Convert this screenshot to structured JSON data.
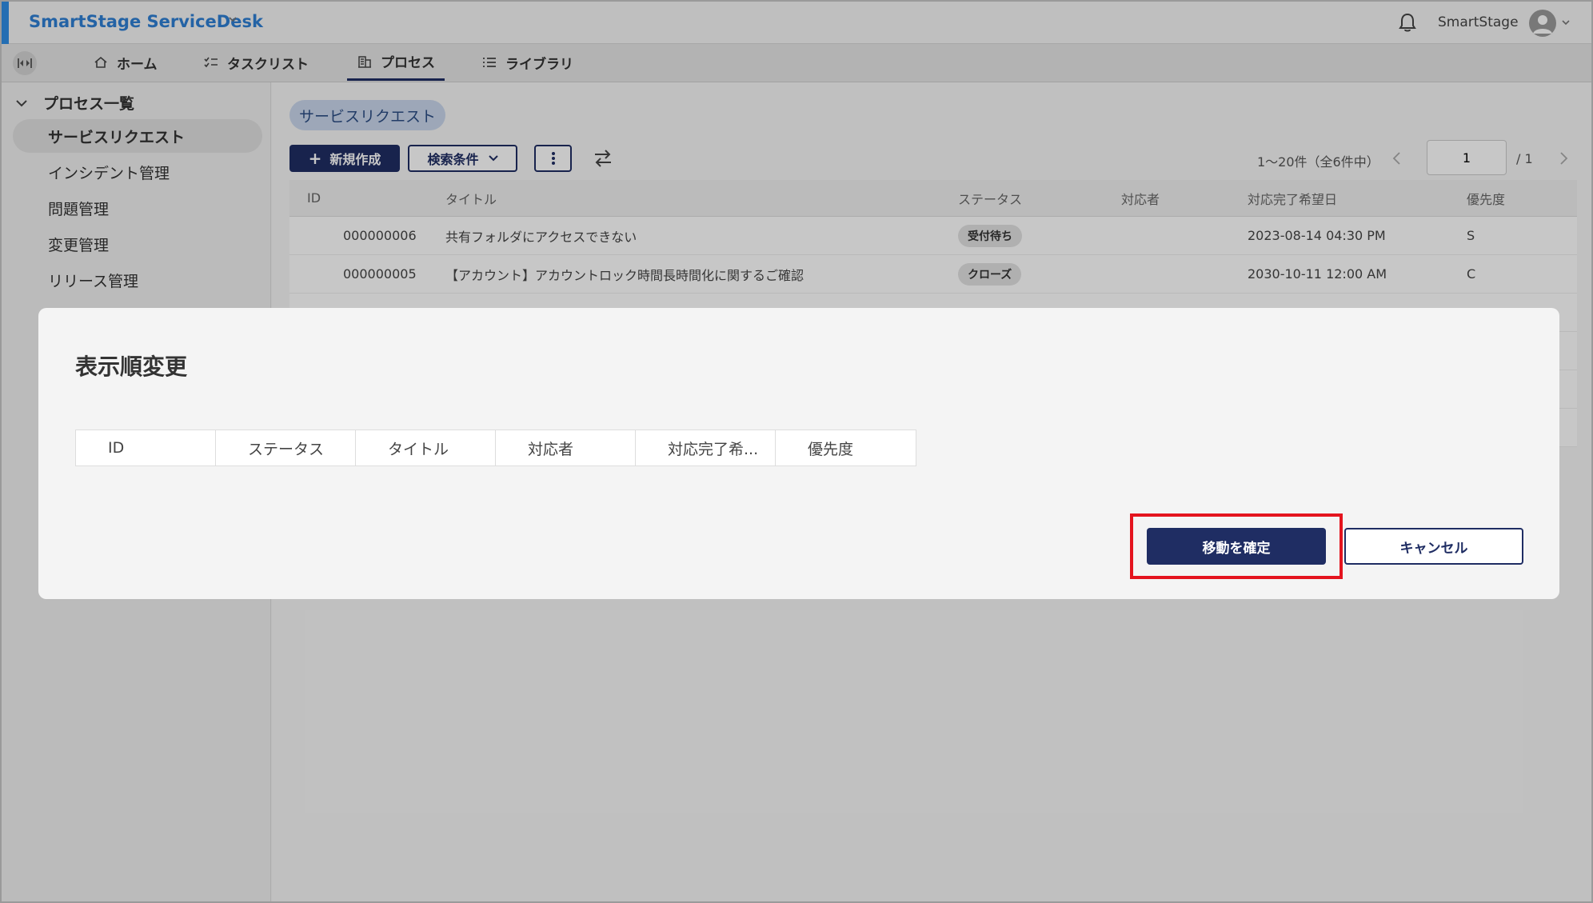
{
  "app": {
    "title": "SmartStage ServiceDesk",
    "user": "SmartStage",
    "accent_color": "#2f8ee6",
    "primary_color": "#1f2d63"
  },
  "nav": {
    "tabs": [
      {
        "label": "ホーム",
        "icon": "home-icon"
      },
      {
        "label": "タスクリスト",
        "icon": "checklist-icon"
      },
      {
        "label": "プロセス",
        "icon": "building-icon",
        "active": true
      },
      {
        "label": "ライブラリ",
        "icon": "list-icon"
      }
    ]
  },
  "sidebar": {
    "header": "プロセス一覧",
    "items": [
      {
        "label": "サービスリクエスト",
        "active": true
      },
      {
        "label": "インシデント管理"
      },
      {
        "label": "問題管理"
      },
      {
        "label": "変更管理"
      },
      {
        "label": "リリース管理"
      }
    ]
  },
  "main": {
    "chip": "サービスリクエスト",
    "new_button": "新規作成",
    "search_button": "検索条件",
    "pager": {
      "summary": "1〜20件（全6件中）",
      "page": "1",
      "total": "/ 1"
    },
    "table": {
      "headers": {
        "id": "ID",
        "title": "タイトル",
        "status": "ステータス",
        "assignee": "対応者",
        "due": "対応完了希望日",
        "priority": "優先度"
      },
      "rows": [
        {
          "id": "000000006",
          "title": "共有フォルダにアクセスできない",
          "status": "受付待ち",
          "assignee": "",
          "due": "2023-08-14 04:30 PM",
          "priority": "S"
        },
        {
          "id": "000000005",
          "title": "【アカウント】アカウントロック時間長時間化に関するご確認",
          "status": "クローズ",
          "assignee": "",
          "due": "2030-10-11 12:00 AM",
          "priority": "C"
        }
      ]
    }
  },
  "modal": {
    "title": "表示順変更",
    "columns": [
      "ID",
      "ステータス",
      "タイトル",
      "対応者",
      "対応完了希...",
      "優先度"
    ],
    "confirm_button": "移動を確定",
    "cancel_button": "キャンセル",
    "highlight_color": "#e4141e"
  }
}
